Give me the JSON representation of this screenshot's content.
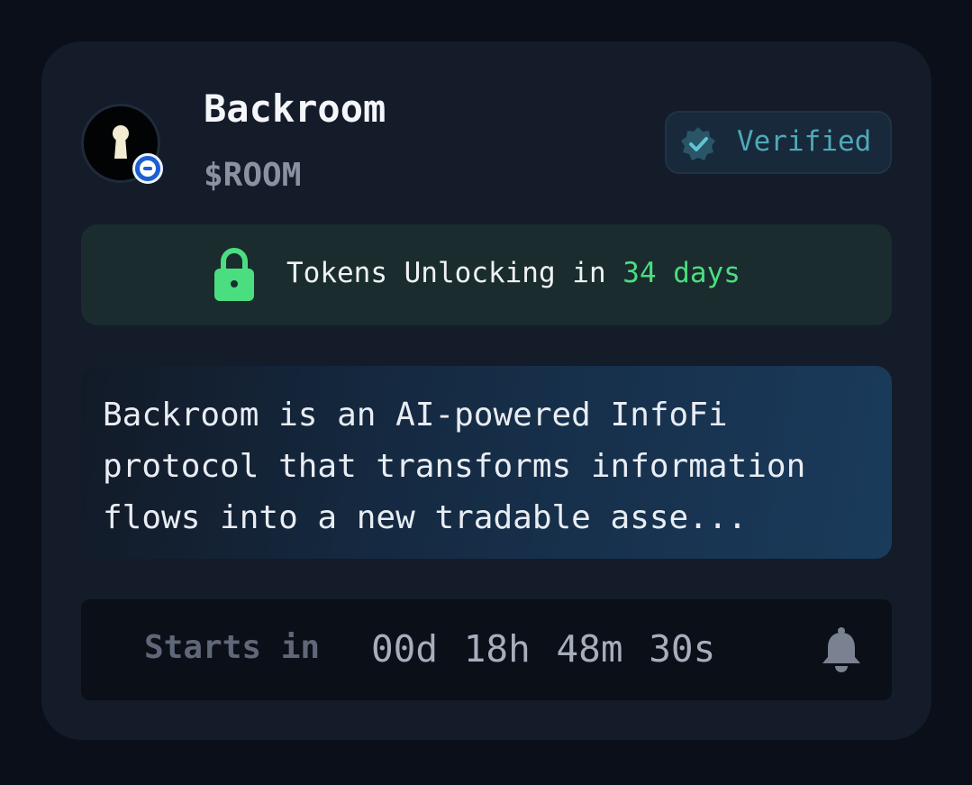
{
  "project": {
    "name": "Backroom",
    "ticker": "$ROOM",
    "avatar_icon": "keyhole-icon",
    "chain_badge_icon": "chain-badge-icon"
  },
  "verified": {
    "label": "Verified",
    "icon": "verified-check-icon",
    "color": "#4ea9b8"
  },
  "unlock": {
    "prefix": "Tokens Unlocking in ",
    "days": "34 days",
    "icon": "lock-icon",
    "accent_color": "#4ade80"
  },
  "description": {
    "text": "Backroom is an AI-powered InfoFi\nprotocol that transforms information\nflows into a new tradable asse..."
  },
  "timer": {
    "label": "Starts in",
    "countdown": "00d 18h 48m 30s",
    "icon": "bell-icon"
  }
}
